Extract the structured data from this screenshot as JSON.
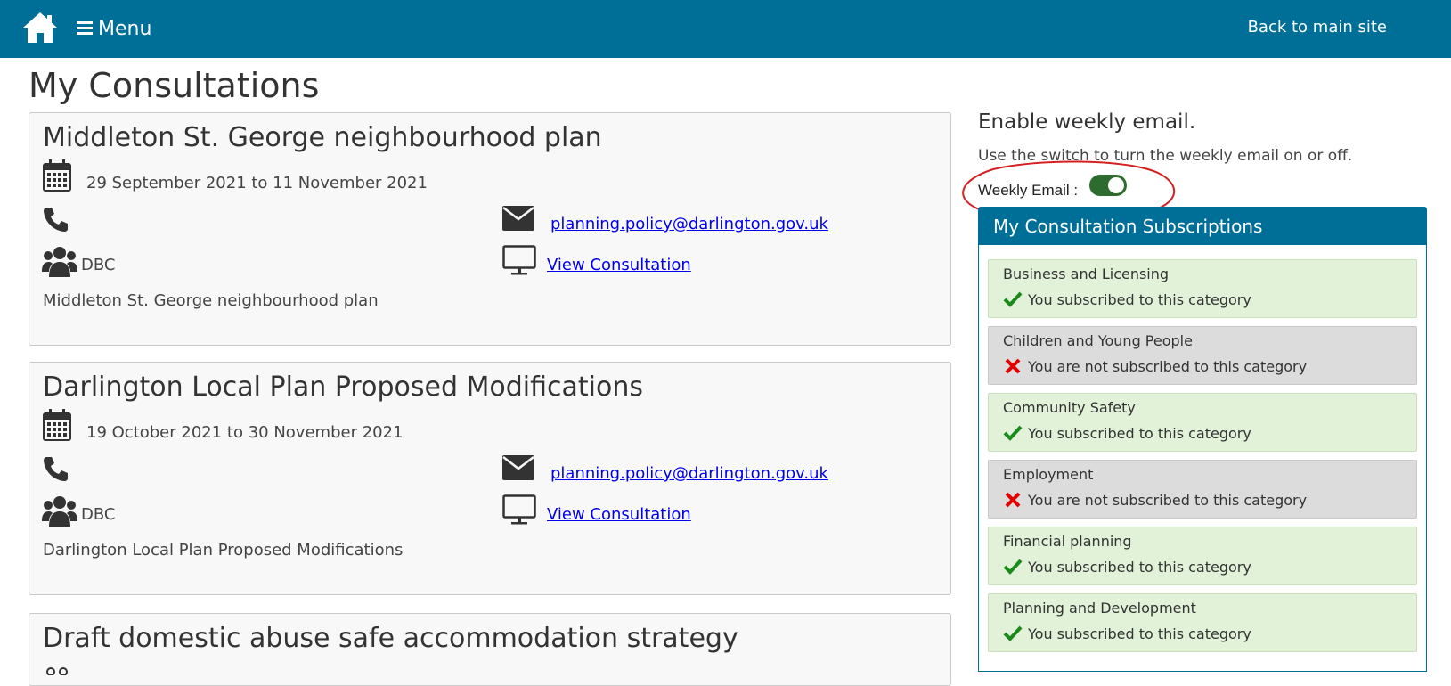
{
  "nav": {
    "menu_label": "Menu",
    "back_label": "Back to main site"
  },
  "page": {
    "title": "My Consultations"
  },
  "consultations": [
    {
      "title": "Middleton St. George neighbourhood plan",
      "dates": "29 September 2021 to 11 November 2021",
      "email": "planning.policy@darlington.gov.uk",
      "org": "DBC",
      "view_label": "View Consultation",
      "description": "Middleton St. George neighbourhood plan"
    },
    {
      "title": "Darlington Local Plan Proposed Modifications",
      "dates": "19 October 2021 to 30 November 2021",
      "email": "planning.policy@darlington.gov.uk",
      "org": "DBC",
      "view_label": "View Consultation",
      "description": "Darlington Local Plan Proposed Modifications"
    },
    {
      "title": "Draft domestic abuse safe accommodation strategy"
    }
  ],
  "weekly": {
    "heading": "Enable weekly email.",
    "sub": "Use the switch to turn the weekly email on or off.",
    "label": "Weekly Email :",
    "enabled": true
  },
  "subscriptions": {
    "title": "My Consultation Subscriptions",
    "items": [
      {
        "name": "Business and Licensing",
        "status": "You subscribed to this category",
        "subscribed": true
      },
      {
        "name": "Children and Young People",
        "status": "You are not subscribed to this category",
        "subscribed": false
      },
      {
        "name": "Community Safety",
        "status": "You subscribed to this category",
        "subscribed": true
      },
      {
        "name": "Employment",
        "status": "You are not subscribed to this category",
        "subscribed": false
      },
      {
        "name": "Financial planning",
        "status": "You subscribed to this category",
        "subscribed": true
      },
      {
        "name": "Planning and Development",
        "status": "You subscribed to this category",
        "subscribed": true
      }
    ]
  },
  "colors": {
    "header_bg": "#006f98",
    "subscribed_bg": "#e2f2d9",
    "unsubscribed_bg": "#dcdcdc",
    "check": "#1a8a1a",
    "cross": "#e00000",
    "toggle_on": "#2e6b2e",
    "annotation": "#d42020"
  }
}
